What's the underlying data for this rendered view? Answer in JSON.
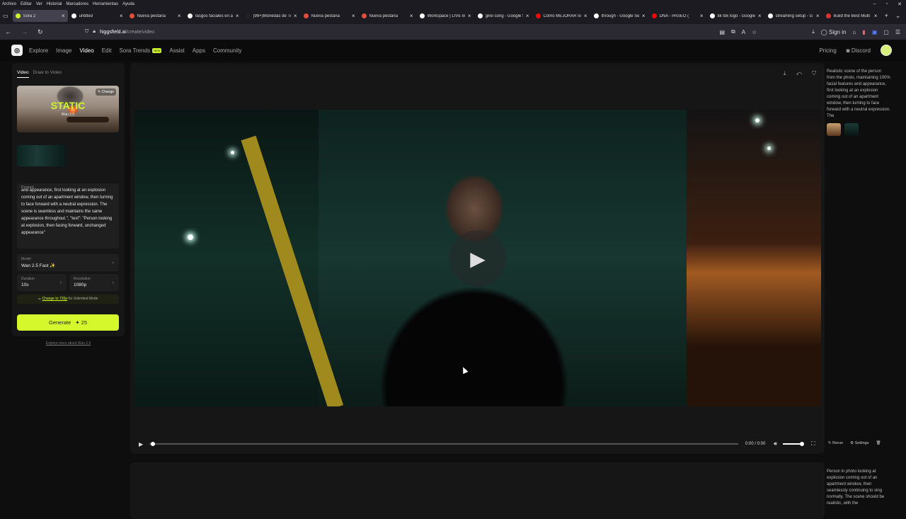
{
  "menubar": {
    "items": [
      "Archivo",
      "Editar",
      "Ver",
      "Historial",
      "Marcadores",
      "Herramientas",
      "Ayuda"
    ]
  },
  "tabs": [
    {
      "title": "Sora 2",
      "color": "#cef52b"
    },
    {
      "title": "untitled",
      "color": "#ffffff"
    },
    {
      "title": "Nueva pestaña",
      "color": "#e44d3a"
    },
    {
      "title": "rasgos faciales en ai",
      "color": "#ffffff"
    },
    {
      "title": "(99+)Monedas de TikTo",
      "color": "#222222"
    },
    {
      "title": "Nueva pestaña",
      "color": "#e44d3a"
    },
    {
      "title": "Nueva pestaña",
      "color": "#e44d3a"
    },
    {
      "title": "Workspace | LIVE Bui",
      "color": "#ffffff"
    },
    {
      "title": "girei song - Google S",
      "color": "#ffffff"
    },
    {
      "title": "Cómo MEJORAR lo",
      "color": "#ff0000"
    },
    {
      "title": "through - Google Se",
      "color": "#ffffff"
    },
    {
      "title": "DNA - PASEO (",
      "color": "#ff0000"
    },
    {
      "title": "tik tok logo - Google",
      "color": "#ffffff"
    },
    {
      "title": "streaming setup - G",
      "color": "#ffffff"
    },
    {
      "title": "Build the Best Multi",
      "color": "#d33"
    }
  ],
  "urlbar": {
    "domain": "higgsfield.ai",
    "path": "/create/video",
    "sign_in": "Sign in"
  },
  "appnav": {
    "links": [
      "Explore",
      "Image",
      "Video",
      "Edit",
      "Sora Trends",
      "Assist",
      "Apps",
      "Community"
    ],
    "new_badge": "NEW",
    "pricing": "Pricing",
    "discord": "Discord"
  },
  "left": {
    "tab_video": "Video",
    "tab_draw": "Draw to Video",
    "thumb_title": "STATIC",
    "thumb_sub": "Wan 2.5",
    "change": "Change",
    "prompt_label": "Prompt",
    "prompt_text": "and appearance, first looking at an explosion coming out of an apartment window, then turning to face forward with a neutral expression. The scene is seamless and maintains the same appearance throughout.\", \"text\": \"Person looking at explosion, then facing forward, unchanged appearance\"",
    "model_label": "Model",
    "model_value": "Wan 2.5 Fast ✨",
    "duration_label": "Duration",
    "duration_value": "10s",
    "resolution_label": "Resolution",
    "resolution_value": "1080p",
    "unlimited_link": "Change to 720p",
    "unlimited_text": " for Unlimited Mode",
    "generate": "Generate",
    "credits": "✦ 25",
    "explore_more": "Explore more about Wan 2.5"
  },
  "player": {
    "time": "0:00 / 0:00",
    "rerun": "Rerun",
    "settings": "Settings"
  },
  "right": {
    "desc1": "Realistic scene of the person from the photo, maintaining 100% facial features and appearance, first looking at an explosion coming out of an apartment window, then turning to face forward with a neutral expression. The",
    "desc2": "Person in photo looking at explosion coming out of an apartment window, then seamlessly continuing to sing normally. The scene should be realistic, with the"
  },
  "colors": {
    "accent": "#d4f82c",
    "bg": "#0e0e0e",
    "panel": "#161616"
  }
}
